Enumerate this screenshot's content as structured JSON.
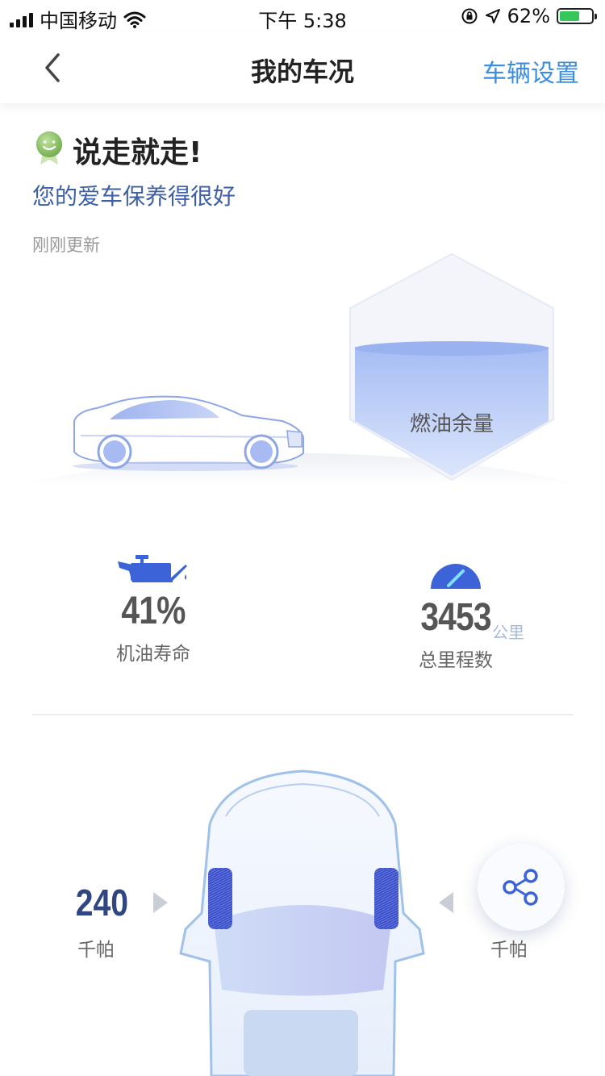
{
  "status_bar": {
    "carrier": "中国移动",
    "time": "下午 5:38",
    "battery_percent": "62%",
    "battery_level": 0.62
  },
  "nav": {
    "title": "我的车况",
    "settings_label": "车辆设置",
    "back_icon": "chevron-left-icon"
  },
  "header": {
    "headline": "说走就走!",
    "subline": "您的爱车保养得很好",
    "updated": "刚刚更新"
  },
  "fuel": {
    "label": "燃油余量"
  },
  "stats": {
    "oil_value": "41%",
    "oil_label": "机油寿命",
    "mileage_value": "3453",
    "mileage_unit": "公里",
    "mileage_label": "总里程数"
  },
  "tires": {
    "left_pressure": "240",
    "left_unit": "千帕",
    "right_unit": "千帕"
  },
  "colors": {
    "accent": "#3b8ee0",
    "dark_blue": "#2f4680",
    "fuel_fill": "#a9c0f5"
  }
}
